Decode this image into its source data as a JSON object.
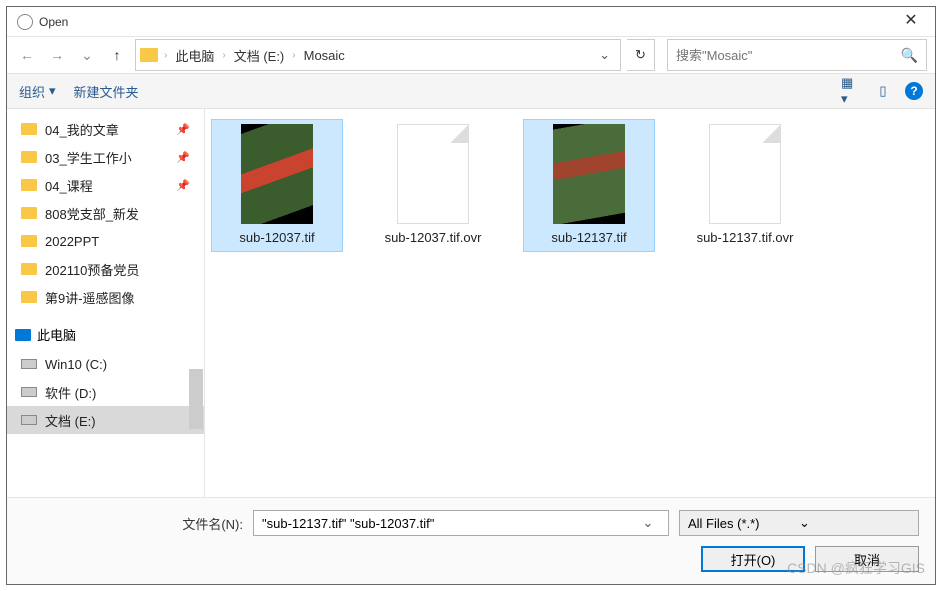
{
  "title": "Open",
  "breadcrumb": {
    "root": "此电脑",
    "drive": "文档 (E:)",
    "folder": "Mosaic"
  },
  "search": {
    "placeholder": "搜索\"Mosaic\""
  },
  "toolbar": {
    "organize": "组织",
    "new_folder": "新建文件夹",
    "help": "?"
  },
  "sidebar": {
    "quick": [
      {
        "label": "04_我的文章",
        "pinned": true
      },
      {
        "label": "03_学生工作小",
        "pinned": true
      },
      {
        "label": "04_课程",
        "pinned": true
      },
      {
        "label": "808党支部_新发",
        "pinned": false
      },
      {
        "label": "2022PPT",
        "pinned": false
      },
      {
        "label": "202110预备党员",
        "pinned": false
      },
      {
        "label": "第9讲-遥感图像",
        "pinned": false
      }
    ],
    "pc_label": "此电脑",
    "drives": [
      {
        "label": "Win10 (C:)"
      },
      {
        "label": "软件 (D:)"
      },
      {
        "label": "文档 (E:)",
        "selected": true
      }
    ]
  },
  "files": [
    {
      "name": "sub-12037.tif",
      "kind": "image1",
      "selected": true
    },
    {
      "name": "sub-12037.tif.ovr",
      "kind": "blank",
      "selected": false
    },
    {
      "name": "sub-12137.tif",
      "kind": "image2",
      "selected": true
    },
    {
      "name": "sub-12137.tif.ovr",
      "kind": "blank",
      "selected": false
    }
  ],
  "bottom": {
    "filename_label": "文件名(N):",
    "filename_value": "\"sub-12137.tif\" \"sub-12037.tif\"",
    "filter": "All Files (*.*)",
    "open": "打开(O)",
    "cancel": "取消"
  },
  "watermark": "CSDN @疯狂学习GIS"
}
